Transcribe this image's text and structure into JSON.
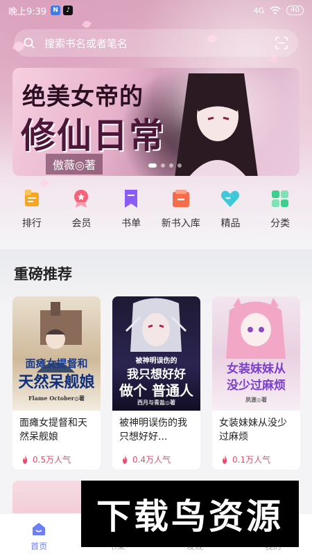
{
  "status_bar": {
    "time": "晚上9:39",
    "apps": [
      {
        "name": "n-app-icon",
        "glyph": "N",
        "color": "#3d7cf0"
      },
      {
        "name": "tiktok-icon",
        "glyph": "♪",
        "color": "#111111"
      }
    ],
    "signal": "4G",
    "battery": "40"
  },
  "search": {
    "placeholder": "搜索书名或者笔名"
  },
  "banner": {
    "title_line1": "绝美女帝的",
    "title_line2": "修仙日常",
    "author": "傲薇◎著",
    "dots": 4,
    "active_dot": 0
  },
  "categories": [
    {
      "label": "排行",
      "icon": "ranking-icon",
      "color": "#f5a623"
    },
    {
      "label": "会员",
      "icon": "vip-badge-icon",
      "color": "#f4627a"
    },
    {
      "label": "书单",
      "icon": "bookmark-icon",
      "color": "#8a5cf5"
    },
    {
      "label": "新书入库",
      "icon": "new-book-icon",
      "color": "#f56c4a"
    },
    {
      "label": "精品",
      "icon": "heart-icon",
      "color": "#3ec8d8"
    },
    {
      "label": "分类",
      "icon": "grid-icon",
      "color": "#3ccf8e"
    }
  ],
  "recommended": {
    "title": "重磅推荐",
    "books": [
      {
        "name": "面瘫女提督和天然呆舰娘",
        "popularity": "0.5万人气",
        "cover_text_1": "面瘫女提督和",
        "cover_text_2": "天然呆舰娘",
        "cover_credit": "Flame October◎著"
      },
      {
        "name": "被神明误伤的我只想好好...",
        "popularity": "0.4万人气",
        "cover_text_1": "被神明误伤的",
        "cover_text_2": "我只想好好",
        "cover_text_3": "做个 普通人",
        "cover_credit": "西月与青盐◎著"
      },
      {
        "name": "女装妹妹从没少过麻烦",
        "popularity": "0.1万人气",
        "cover_text_1": "女装妹妹从",
        "cover_text_2": "没少过麻烦",
        "cover_credit": "夙澈◎著"
      }
    ]
  },
  "bottom_nav": [
    {
      "label": "首页",
      "icon": "home-icon",
      "active": true
    },
    {
      "label": "书架",
      "icon": "bookshelf-icon",
      "active": false
    },
    {
      "label": "发现",
      "icon": "discover-icon",
      "active": false
    },
    {
      "label": "我的",
      "icon": "profile-icon",
      "active": false
    }
  ],
  "watermark": {
    "text": "下载鸟资源"
  },
  "colors": {
    "accent": "#6d7ef7",
    "popularity": "#e84c6d"
  }
}
